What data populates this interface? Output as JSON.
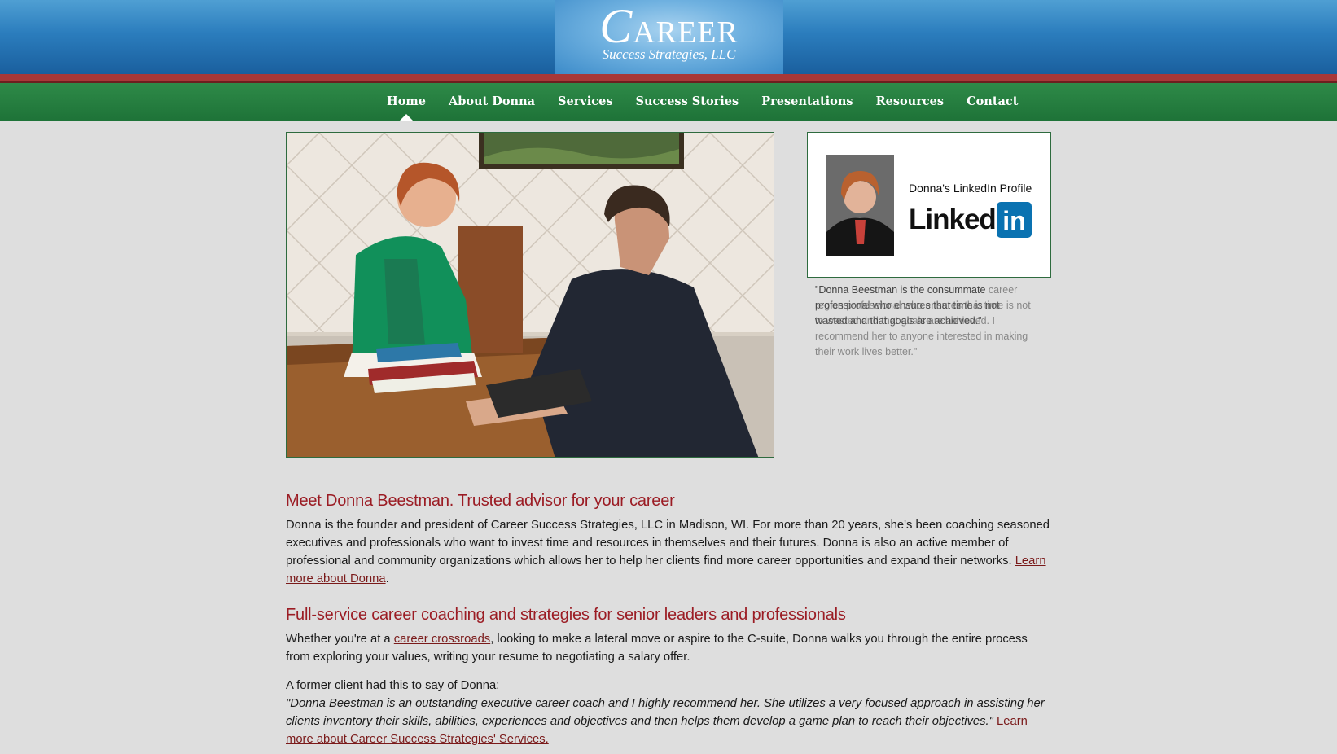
{
  "header": {
    "logo_main": "CAREER",
    "logo_big_letter": "C",
    "logo_rest": "AREER",
    "logo_sub": "Success Strategies, LLC"
  },
  "nav": {
    "items": [
      {
        "label": "Home",
        "active": true
      },
      {
        "label": "About Donna"
      },
      {
        "label": "Services"
      },
      {
        "label": "Success Stories"
      },
      {
        "label": "Presentations"
      },
      {
        "label": "Resources"
      },
      {
        "label": "Contact"
      }
    ]
  },
  "linkedin": {
    "label": "Donna's LinkedIn Profile",
    "word": "Linked",
    "badge": "in",
    "brand_color": "#0a72b1"
  },
  "testimonial": {
    "layer1": "\"Donna Beestman is the consummate career region professional who ensures that time is not to wasted and that goals are achieved. I recommend her to anyone interested in making their work lives better.\"",
    "layer2": "\"Donna Beestman is the consummate professional who ensures that time is not wasted and that goals are achieved.\""
  },
  "main": {
    "heading1": "Meet Donna Beestman. Trusted advisor for your career",
    "para1": "Donna is the founder and president of Career Success Strategies, LLC in Madison, WI. For more than 20 years, she's been coaching seasoned executives and professionals who want to invest time and resources in themselves and their futures. Donna is also an active member of professional and community organizations which allows her to help her clients find more career opportunities and expand their networks.",
    "link1": "Learn more about Donna",
    "heading2": "Full-service career coaching and strategies for senior leaders and professionals",
    "para2_before": "Whether you're at a ",
    "link2": "career crossroads",
    "para2_after": ", looking to make a lateral move or aspire to the C-suite, Donna walks you through the entire process from exploring your values, writing your resume to negotiating a salary offer.",
    "client_intro": "A former client had this to say of Donna:",
    "client_quote": "\"Donna Beestman is an outstanding executive career coach and I highly recommend her. She utilizes a very focused approach in assisting her clients inventory their skills, abilities, experiences and objectives and then helps them develop a game plan to reach their objectives.\"",
    "link3": "Learn more about Career Success Strategies' Services."
  },
  "colors": {
    "header_blue": "#2b7dbd",
    "accent_red": "#a83838",
    "nav_green": "#1e7338",
    "heading_red": "#9b1c24"
  }
}
